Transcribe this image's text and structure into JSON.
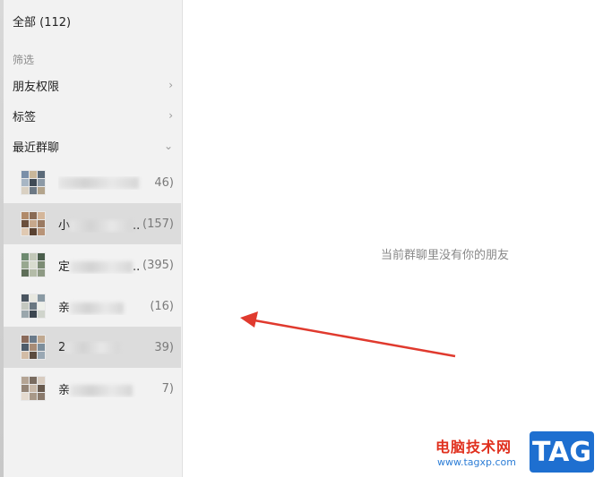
{
  "sidebar": {
    "all": "全部 (112)",
    "filter_label": "筛选",
    "friend_permissions": "朋友权限",
    "tags": "标签",
    "recent_groups": "最近群聊",
    "groups": [
      {
        "name": "",
        "count": "46)",
        "selected": false
      },
      {
        "name": "小",
        "count": "(157)",
        "selected": true
      },
      {
        "name": "定",
        "count": "(395)",
        "selected": false
      },
      {
        "name": "亲",
        "count": "(16)",
        "selected": false
      },
      {
        "name": "2",
        "count": "39)",
        "selected": true
      },
      {
        "name": "亲",
        "count": "7)",
        "selected": false
      }
    ]
  },
  "main": {
    "empty_message": "当前群聊里没有你的朋友"
  },
  "watermark": {
    "site_name": "电脑技术网",
    "url": "www.tagxp.com",
    "tag": "TAG"
  },
  "colors": {
    "arrow": "#e03a2e",
    "selected_bg": "#dcdcdc",
    "sidebar_bg": "#f2f2f2"
  }
}
